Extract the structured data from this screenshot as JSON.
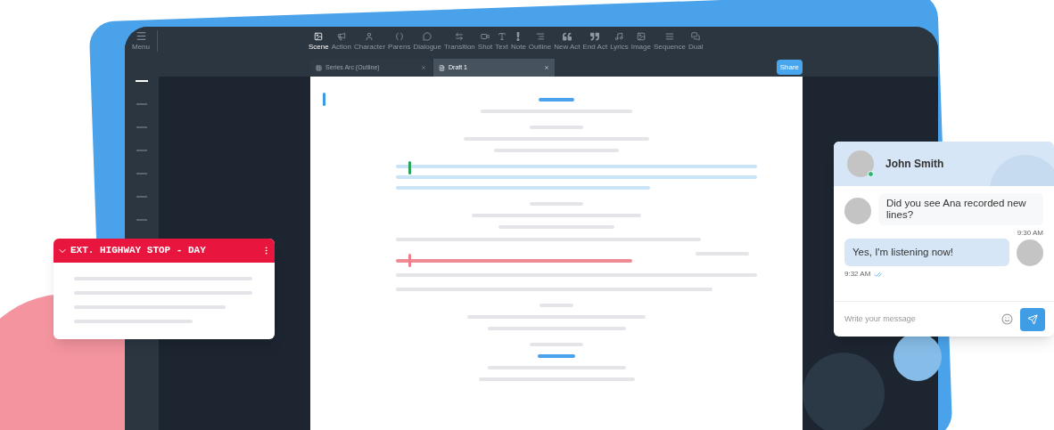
{
  "menu": {
    "label": "Menu"
  },
  "sidebar": [
    {
      "selected": true
    },
    {
      "selected": false
    },
    {
      "selected": false
    },
    {
      "selected": false
    },
    {
      "selected": false
    },
    {
      "selected": false
    },
    {
      "selected": false
    }
  ],
  "toolbar": [
    {
      "label": "Scene",
      "selected": true
    },
    {
      "label": "Action",
      "selected": false
    },
    {
      "label": "Character",
      "selected": false
    },
    {
      "label": "Parens",
      "selected": false
    },
    {
      "label": "Dialogue",
      "selected": false
    },
    {
      "label": "Transition",
      "selected": false
    },
    {
      "label": "Shot",
      "selected": false
    },
    {
      "label": "Text",
      "selected": false
    },
    {
      "label": "Note",
      "selected": false
    },
    {
      "label": "Outline",
      "selected": false
    },
    {
      "label": "New Act",
      "selected": false
    },
    {
      "label": "End Act",
      "selected": false
    },
    {
      "label": "Lyrics",
      "selected": false
    },
    {
      "label": "Image",
      "selected": false
    },
    {
      "label": "Sequence",
      "selected": false
    },
    {
      "label": "Dual",
      "selected": false
    }
  ],
  "tabs": [
    {
      "label": "Series Arc (Outline)",
      "kind": "outline",
      "selected": false
    },
    {
      "label": "Draft 1",
      "kind": "draft",
      "selected": true
    }
  ],
  "share_button": "Share",
  "scene_card": {
    "title": "EXT. HIGHWAY STOP - DAY",
    "expanded": true
  },
  "chat": {
    "contact": "John Smith",
    "online": true,
    "messages": [
      {
        "kind": "incoming",
        "text": "Did you see Ana recorded new lines?",
        "time": "9:30 AM"
      },
      {
        "kind": "outgoing",
        "text": "Yes, I'm listening now!",
        "time": "9:32 AM",
        "read": true
      }
    ],
    "input": {
      "placeholder": "Write your message"
    }
  }
}
